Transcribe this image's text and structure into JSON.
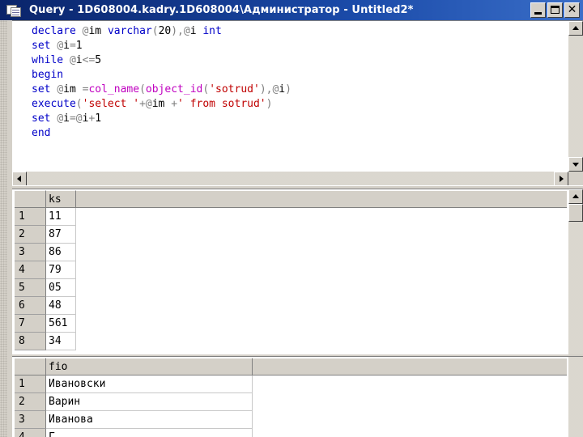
{
  "window": {
    "title": "Query - 1D608004.kadry.1D608004\\Администратор - Untitled2*",
    "buttons": {
      "minimize": "_",
      "maximize": "□",
      "close": "✕"
    }
  },
  "editor": {
    "lines": [
      [
        [
          "kw",
          "declare "
        ],
        [
          "op",
          "@"
        ],
        [
          "txt",
          "im "
        ],
        [
          "kw",
          "varchar"
        ],
        [
          "op",
          "("
        ],
        [
          "txt",
          "20"
        ],
        [
          "op",
          "),@"
        ],
        [
          "txt",
          "i "
        ],
        [
          "kw",
          "int"
        ]
      ],
      [
        [
          "kw",
          "set "
        ],
        [
          "op",
          "@"
        ],
        [
          "txt",
          "i"
        ],
        [
          "op",
          "="
        ],
        [
          "txt",
          "1"
        ]
      ],
      [
        [
          "kw",
          "while "
        ],
        [
          "op",
          "@"
        ],
        [
          "txt",
          "i"
        ],
        [
          "op",
          "<="
        ],
        [
          "txt",
          "5"
        ]
      ],
      [
        [
          "kw",
          "begin"
        ]
      ],
      [
        [
          "kw",
          "set "
        ],
        [
          "op",
          "@"
        ],
        [
          "txt",
          "im "
        ],
        [
          "op",
          "="
        ],
        [
          "fn",
          "col_name"
        ],
        [
          "op",
          "("
        ],
        [
          "fn",
          "object_id"
        ],
        [
          "op",
          "("
        ],
        [
          "str",
          "'sotrud'"
        ],
        [
          "op",
          "),@"
        ],
        [
          "txt",
          "i"
        ],
        [
          "op",
          ")"
        ]
      ],
      [
        [
          "kw",
          "execute"
        ],
        [
          "op",
          "("
        ],
        [
          "str",
          "'select '"
        ],
        [
          "op",
          "+@"
        ],
        [
          "txt",
          "im "
        ],
        [
          "op",
          "+"
        ],
        [
          "str",
          "' from sotrud'"
        ],
        [
          "op",
          ")"
        ]
      ],
      [
        [
          "kw",
          "set "
        ],
        [
          "op",
          "@"
        ],
        [
          "txt",
          "i"
        ],
        [
          "op",
          "=@"
        ],
        [
          "txt",
          "i"
        ],
        [
          "op",
          "+"
        ],
        [
          "txt",
          "1"
        ]
      ],
      [
        [
          "kw",
          "end"
        ]
      ]
    ]
  },
  "grid1": {
    "column": "ks",
    "rows": [
      {
        "n": "1",
        "v": "11"
      },
      {
        "n": "2",
        "v": "87"
      },
      {
        "n": "3",
        "v": "86"
      },
      {
        "n": "4",
        "v": "79"
      },
      {
        "n": "5",
        "v": "05"
      },
      {
        "n": "6",
        "v": "48"
      },
      {
        "n": "7",
        "v": "561"
      },
      {
        "n": "8",
        "v": "34"
      }
    ]
  },
  "grid2": {
    "column": "fio",
    "rows": [
      {
        "n": "1",
        "v": "Ивановски"
      },
      {
        "n": "2",
        "v": "Варин"
      },
      {
        "n": "3",
        "v": "Иванова"
      },
      {
        "n": "4",
        "v": "Г"
      }
    ]
  },
  "colors": {
    "keyword": "#0000c8",
    "function": "#c000c0",
    "string": "#c00000",
    "operator": "#808080"
  }
}
